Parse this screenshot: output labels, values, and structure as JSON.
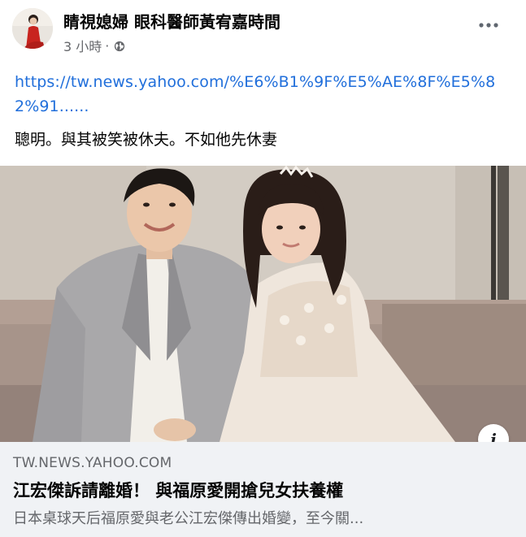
{
  "post": {
    "author": "睛視媳婦 眼科醫師黃宥嘉時間",
    "time": "3 小時",
    "separator": "·",
    "privacy_icon": "globe-icon",
    "more_icon": "more-options-icon",
    "link_text": "https://tw.news.yahoo.com/%E6%B1%9F%E5%AE%8F%E5%82%91......",
    "caption": "聰明。與其被笑被休夫。不如他先休妻"
  },
  "preview": {
    "domain": "TW.NEWS.YAHOO.COM",
    "headline": "江宏傑訴請離婚！ 與福原愛開搶兒女扶養權",
    "description": "日本桌球天后福原愛與老公江宏傑傳出婚變，至今關...",
    "info_label": "i"
  },
  "colors": {
    "link": "#216fdb",
    "secondary_text": "#65676b",
    "preview_bg": "#f0f2f5"
  }
}
